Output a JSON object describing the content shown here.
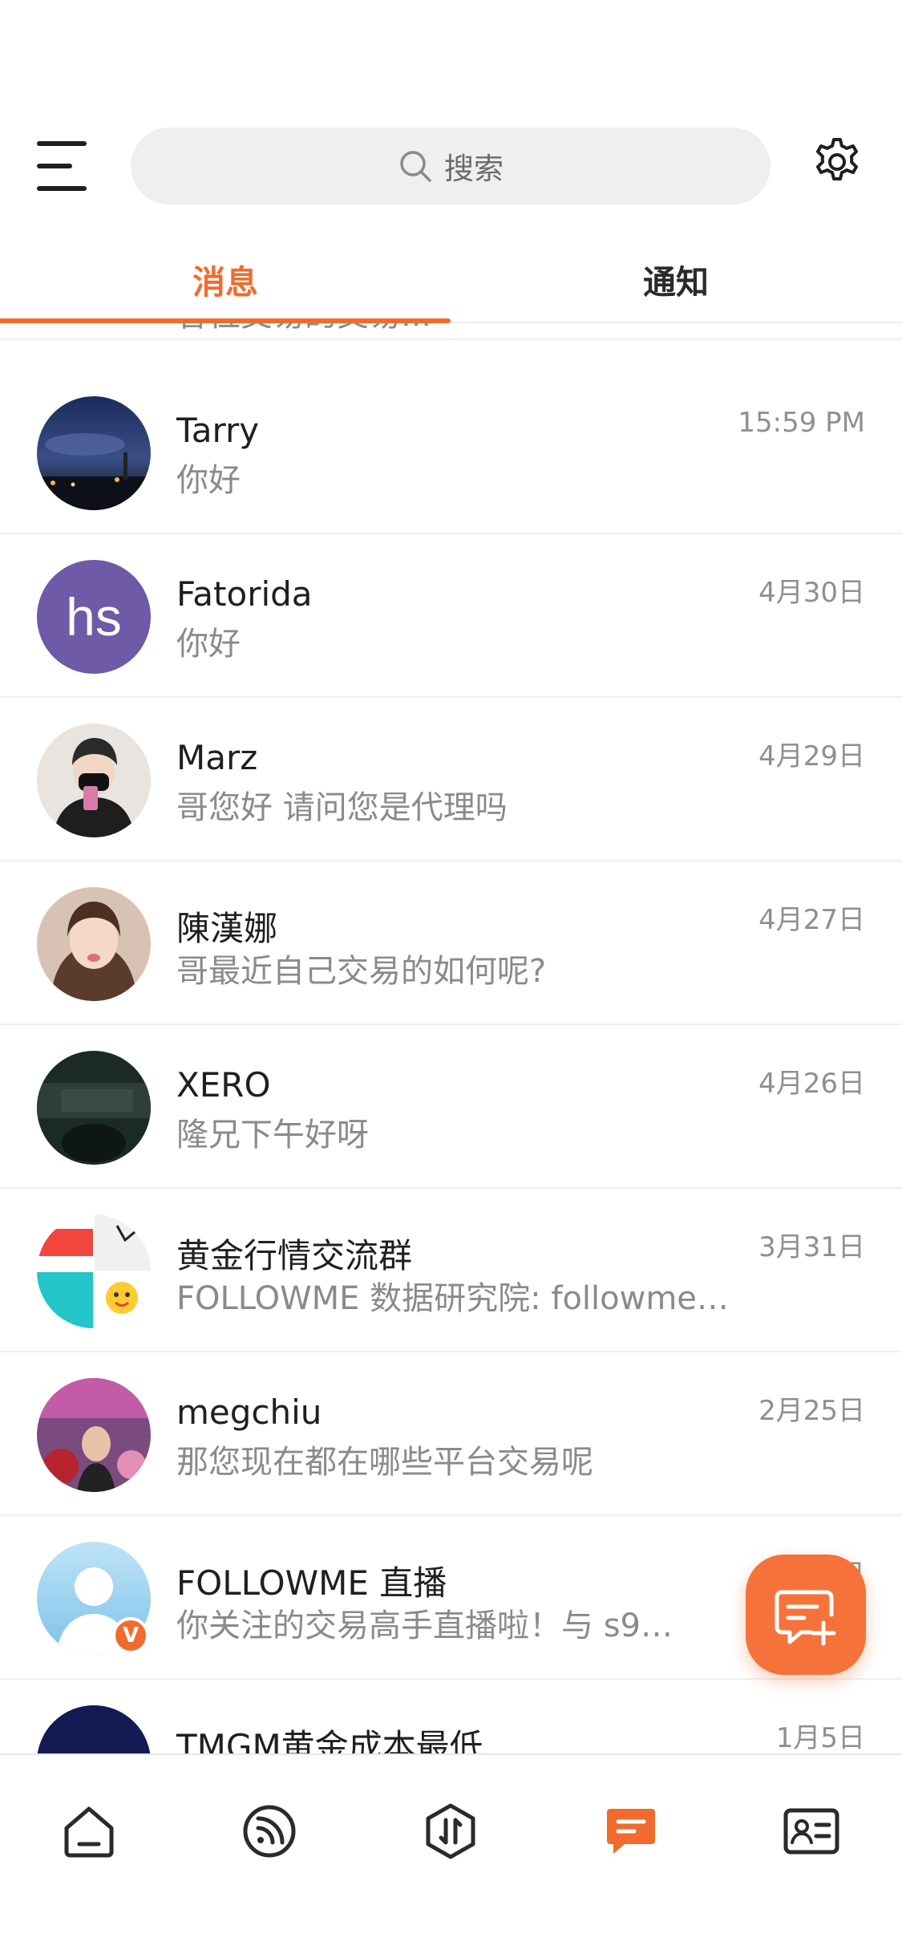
{
  "header": {
    "search_placeholder": "搜索"
  },
  "tabs": [
    {
      "label": "消息",
      "active": true
    },
    {
      "label": "通知",
      "active": false
    }
  ],
  "colors": {
    "accent": "#f26b2e",
    "text_primary": "#1f1f1f",
    "text_secondary": "#8a8a8a"
  },
  "partial_row": {
    "preview": "各位交易的交易..."
  },
  "conversations": [
    {
      "name": "Tarry",
      "preview": "你好",
      "time": "15:59 PM",
      "avatar": "night-city-photo"
    },
    {
      "name": "Fatorida",
      "preview": "你好",
      "time": "4月30日",
      "avatar_text": "hs",
      "avatar_color": "#6e5aa6"
    },
    {
      "name": "Marz",
      "preview": "哥您好 请问您是代理吗",
      "time": "4月29日",
      "avatar": "person-photo"
    },
    {
      "name": "陳漢娜",
      "preview": "哥最近自己交易的如何呢?",
      "time": "4月27日",
      "avatar": "person-photo"
    },
    {
      "name": "XERO",
      "preview": "隆兄下午好呀",
      "time": "4月26日",
      "avatar": "dark-photo"
    },
    {
      "name": "黄金行情交流群",
      "preview": "FOLLOWME 数据研究院: followme…",
      "time": "3月31日",
      "avatar": "group-collage"
    },
    {
      "name": "megchiu",
      "preview": "那您现在都在哪些平台交易呢",
      "time": "2月25日",
      "avatar": "person-photo"
    },
    {
      "name": "FOLLOWME 直播",
      "preview": "你关注的交易高手直播啦！与 s9…",
      "time": "2月?日",
      "avatar": "default-person",
      "verified": "V"
    },
    {
      "name": "TMGM黄金成本最低",
      "preview": "",
      "time": "1月5日",
      "avatar": "tmgm-logo"
    }
  ],
  "bottom_nav": [
    {
      "icon": "home-icon",
      "active": false
    },
    {
      "icon": "feed-icon",
      "active": false
    },
    {
      "icon": "trade-icon",
      "active": false
    },
    {
      "icon": "messages-icon",
      "active": true
    },
    {
      "icon": "profile-card-icon",
      "active": false
    }
  ]
}
